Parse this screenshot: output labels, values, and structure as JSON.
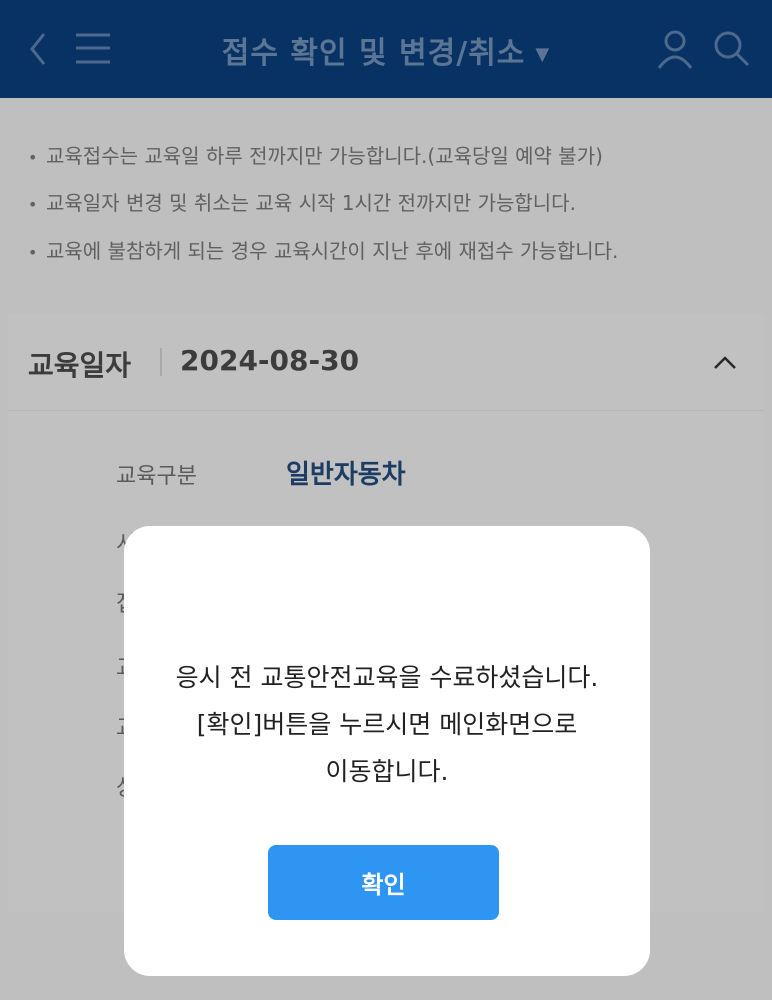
{
  "header": {
    "title": "접수 확인 및 변경/취소",
    "title_caret": "▼"
  },
  "notice": {
    "items": [
      "교육접수는 교육일 하루 전까지만 가능합니다.(교육당일 예약 불가)",
      "교육일자 변경 및 취소는 교육 시작 1시간 전까지만 가능합니다.",
      "교육에 불참하게 되는 경우 교육시간이 지난 후에 재접수 가능합니다."
    ],
    "bullet": "•"
  },
  "card": {
    "date_label": "교육일자",
    "date_value": "2024-08-30",
    "rows": [
      {
        "label": "교육구분",
        "value": "일반자동차"
      },
      {
        "label": "시",
        "value": ""
      },
      {
        "label": "접",
        "value": ""
      },
      {
        "label": "교",
        "value": ""
      },
      {
        "label": "교",
        "value": ""
      },
      {
        "label": "상",
        "value": ""
      }
    ]
  },
  "modal": {
    "message_lines": [
      "응시 전 교통안전교육을 수료하셨습니다.",
      "[확인]버튼을 누르시면 메인화면으로",
      "이동합니다."
    ],
    "confirm_label": "확인"
  },
  "colors": {
    "header_bg": "#0a3d7a",
    "button_bg": "#2e95f3"
  },
  "icons": [
    "back-icon",
    "menu-icon",
    "user-icon",
    "search-icon",
    "chevron-up-icon"
  ]
}
